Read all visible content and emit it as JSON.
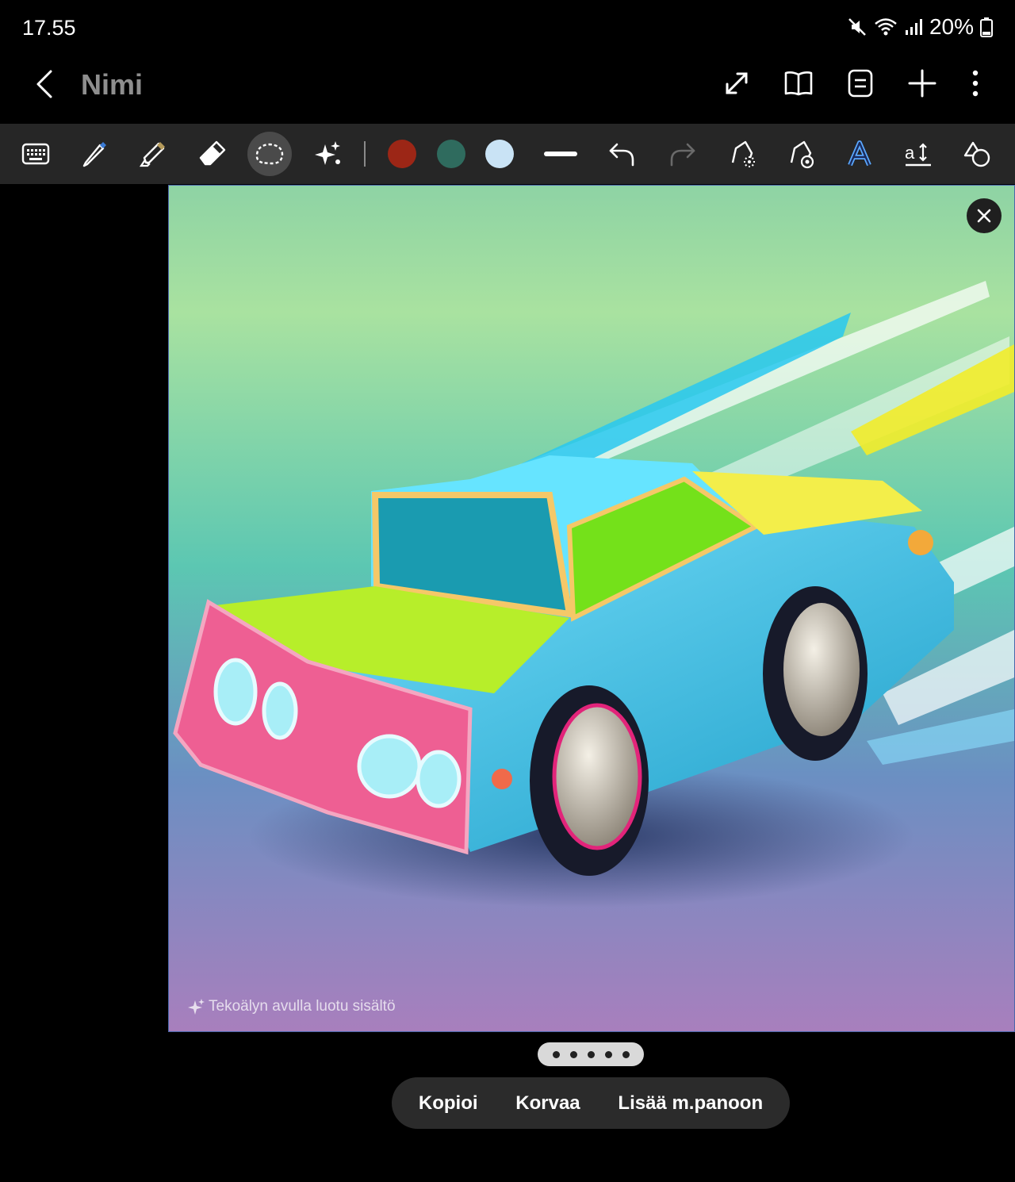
{
  "status_bar": {
    "time": "17.55",
    "battery": "20%"
  },
  "header": {
    "title": "Nimi",
    "actions": [
      "expand-icon",
      "book-icon",
      "text-view-icon",
      "add-icon",
      "more-icon"
    ]
  },
  "toolbar": {
    "tools": [
      "keyboard-icon",
      "pen-icon",
      "highlighter-icon",
      "eraser-icon",
      "lasso-icon",
      "ai-sparkle-icon"
    ],
    "active_tool": "lasso-icon",
    "colors": [
      "#9c2616",
      "#2f6b5e",
      "#c9e3f5"
    ],
    "extra": [
      "stroke-width-icon",
      "undo-icon",
      "redo-icon",
      "shape-pen-icon",
      "pen-settings-icon",
      "text-style-icon",
      "text-size-icon",
      "shapes-icon"
    ]
  },
  "image": {
    "ai_label": "Tekoälyn avulla luotu sisältö"
  },
  "context_menu": {
    "copy": "Kopioi",
    "replace": "Korvaa",
    "add_to_clipboard": "Lisää m.panoon"
  }
}
